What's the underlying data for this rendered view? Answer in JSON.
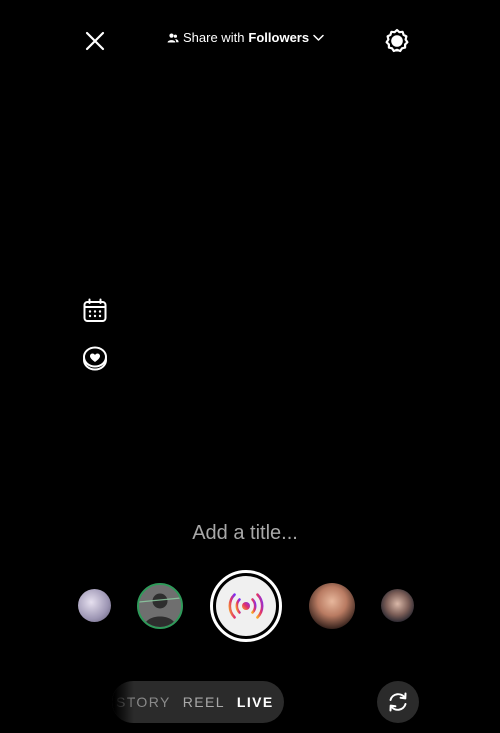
{
  "header": {
    "share_prefix": "Share with",
    "share_audience": "Followers"
  },
  "title_field": {
    "value": "",
    "placeholder": "Add a title..."
  },
  "modes": {
    "story": "STORY",
    "reel": "REEL",
    "live": "LIVE",
    "active": "LIVE"
  },
  "icons": {
    "close": "close-icon",
    "audience": "people-icon",
    "chevron": "chevron-down-icon",
    "settings": "gear-icon",
    "schedule": "calendar-icon",
    "fundraiser": "heart-coin-icon",
    "capture": "live-broadcast-icon",
    "flip": "camera-flip-icon"
  },
  "colors": {
    "background": "#000000",
    "placeholder": "#a8a8a8",
    "pill": "#2b2b2b",
    "live_gradient_start": "#f9a825",
    "live_gradient_mid": "#e1306c",
    "live_gradient_end": "#7b2ff7"
  }
}
